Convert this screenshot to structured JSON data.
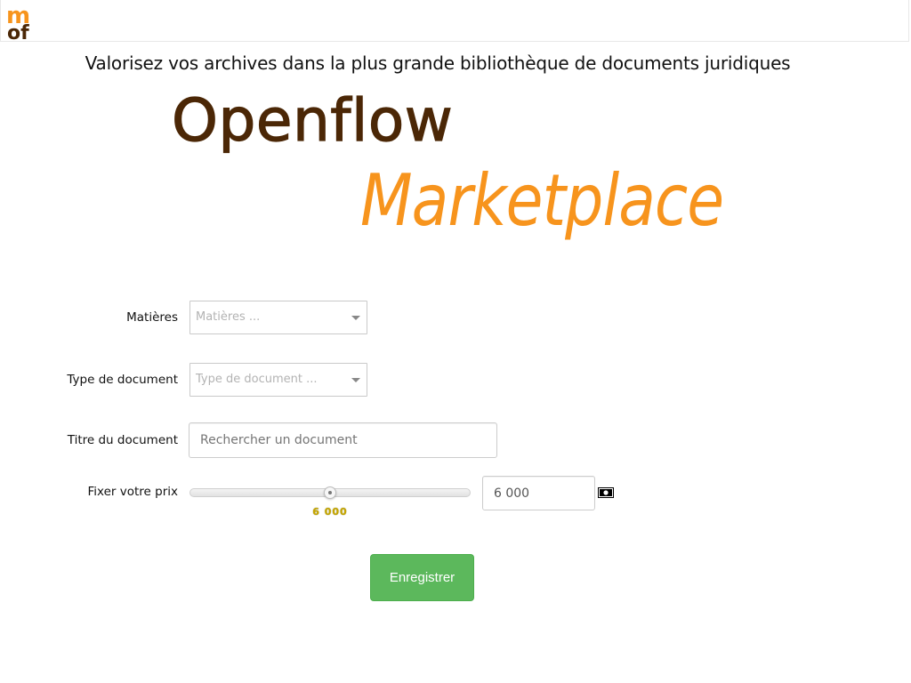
{
  "header": {
    "logo_top": "m",
    "logo_bottom": "of"
  },
  "tagline": "Valorisez vos archives dans la plus grande bibliothèque de documents juridiques",
  "brand": {
    "name": "Openflow",
    "product": "Marketplace"
  },
  "form": {
    "subjects": {
      "label": "Matières",
      "placeholder": "Matières ..."
    },
    "doc_type": {
      "label": "Type de document",
      "placeholder": "Type de document ..."
    },
    "doc_title": {
      "label": "Titre du document",
      "placeholder": "Rechercher un document"
    },
    "price": {
      "label": "Fixer votre prix",
      "slider_value_text": "6 000",
      "slider_fraction": 0.5,
      "input_value": "6 000",
      "icon": "money-icon"
    },
    "save_label": "Enregistrer"
  },
  "colors": {
    "brand_brown": "#4b2706",
    "brand_orange": "#f7941d",
    "button_green": "#5cb85c",
    "slider_value": "#c8a600"
  }
}
